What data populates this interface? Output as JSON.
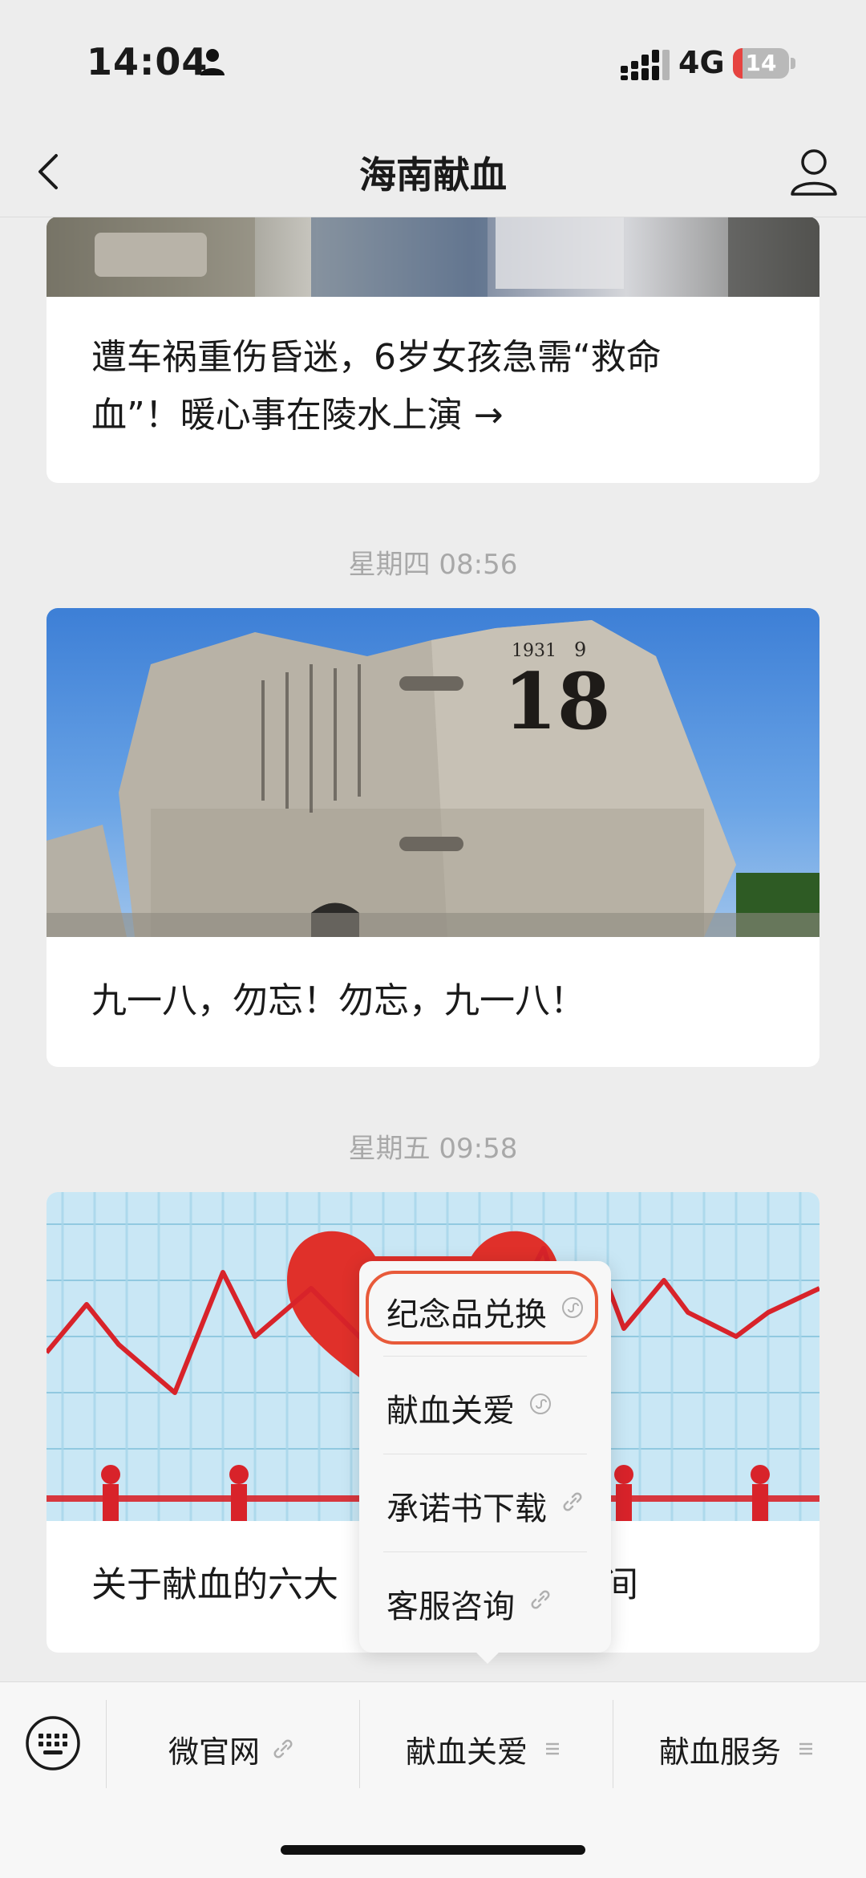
{
  "status_bar": {
    "time": "14:04",
    "network": "4G",
    "battery": "14"
  },
  "nav": {
    "title": "海南献血"
  },
  "feed": {
    "card1": {
      "title_line1": "遭车祸重伤昏迷，6岁女孩急需“救命",
      "title_line2": "血”！暖心事在陵水上演 →"
    },
    "ts2": "星期四 08:56",
    "card2": {
      "title": "九一八，勿忘！勿忘，九一八！"
    },
    "ts3": "星期五 09:58",
    "card3": {
      "title_left": "关于献血的六大",
      "title_right": "间"
    }
  },
  "popup_menu": {
    "items": [
      {
        "label": "纪念品兑换",
        "icon": "mini-program-icon"
      },
      {
        "label": "献血关爱",
        "icon": "mini-program-icon"
      },
      {
        "label": "承诺书下载",
        "icon": "link-icon"
      },
      {
        "label": "客服咨询",
        "icon": "link-icon"
      }
    ]
  },
  "bottom_menu": {
    "tabs": [
      {
        "label": "微官网",
        "icon": "link-icon"
      },
      {
        "label": "献血关爱",
        "icon": "submenu-icon"
      },
      {
        "label": "献血服务",
        "icon": "submenu-icon"
      }
    ]
  },
  "colors": {
    "highlight": "#e85a3a",
    "battery_low": "#e64340",
    "ecg_red": "#d8232a",
    "heart_red": "#e0302a"
  }
}
